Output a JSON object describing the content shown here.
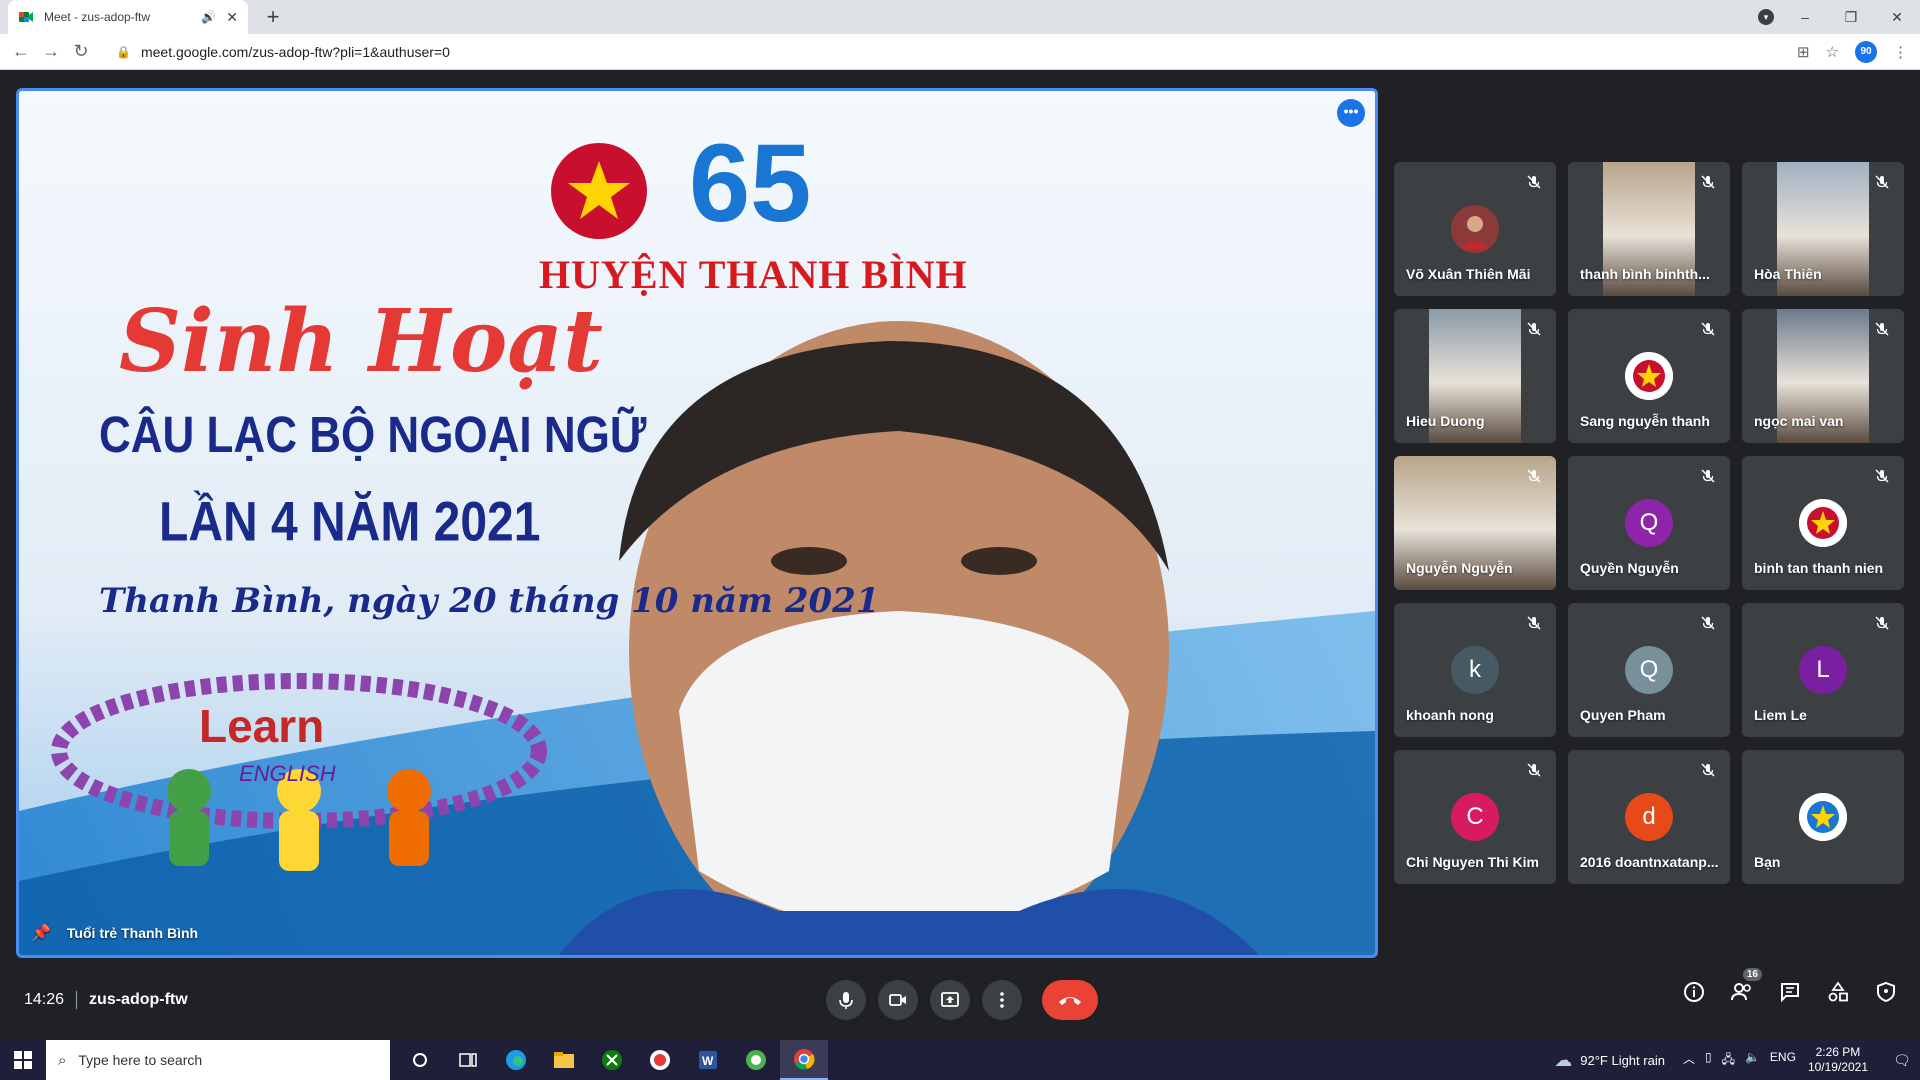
{
  "browser": {
    "tab_title": "Meet - zus-adop-ftw",
    "new_tab_symbol": "+",
    "url": "meet.google.com/zus-adop-ftw?pli=1&authuser=0",
    "window_controls": [
      "–",
      "❐",
      "✕"
    ]
  },
  "main_video": {
    "participant_name": "Tuổi trẻ Thanh Bình",
    "slide": {
      "badge_number": "65",
      "org": "HUYỆN THANH BÌNH",
      "title_script": "Sinh Hoạt",
      "line1": "CÂU LẠC BỘ NGOẠI NGỮ",
      "line2": "LẦN 4 NĂM 2021",
      "date_line": "Thanh Bình, ngày 20 tháng 10 năm 2021",
      "learn": "Learn",
      "english": "ENGLISH"
    }
  },
  "participants": [
    {
      "name": "Võ Xuân Thiên Mãi",
      "avatar": "photo",
      "avatar_color": "#8b3a3a",
      "muted": true
    },
    {
      "name": "thanh bình binhth...",
      "avatar": "video",
      "muted": true
    },
    {
      "name": "Hòa Thiên",
      "avatar": "video",
      "muted": true
    },
    {
      "name": "Hieu Duong",
      "avatar": "video",
      "muted": true
    },
    {
      "name": "Sang nguyễn thanh",
      "avatar": "logo",
      "avatar_color": "#ffffff",
      "muted": true
    },
    {
      "name": "ngọc mai van",
      "avatar": "video",
      "muted": true
    },
    {
      "name": "Nguyễn Nguyễn",
      "avatar": "video-full",
      "muted": true
    },
    {
      "name": "Quyền Nguyễn",
      "avatar": "Q",
      "avatar_color": "#8e24aa",
      "muted": true
    },
    {
      "name": "binh tan thanh nien",
      "avatar": "logo",
      "avatar_color": "#ffffff",
      "muted": true
    },
    {
      "name": "khoanh nong",
      "avatar": "k",
      "avatar_color": "#455a64",
      "muted": true
    },
    {
      "name": "Quyen Pham",
      "avatar": "Q",
      "avatar_color": "#78909c",
      "muted": true
    },
    {
      "name": "Liem Le",
      "avatar": "L",
      "avatar_color": "#7b1fa2",
      "muted": true
    },
    {
      "name": "Chi Nguyen Thi Kim",
      "avatar": "C",
      "avatar_color": "#d81b60",
      "muted": true
    },
    {
      "name": "2016 doantnxatanp...",
      "avatar": "d",
      "avatar_color": "#e64a19",
      "muted": true
    },
    {
      "name": "Bạn",
      "avatar": "logo90",
      "avatar_color": "#ffffff",
      "muted": false
    }
  ],
  "bottom_bar": {
    "time": "14:26",
    "meeting_code": "zus-adop-ftw",
    "people_count": "16"
  },
  "taskbar": {
    "search_placeholder": "Type here to search",
    "weather": "92°F  Light rain",
    "language": "ENG",
    "time": "2:26 PM",
    "date": "10/19/2021"
  },
  "colors": {
    "accent_blue": "#1a73e8",
    "end_call_red": "#ea4335",
    "tile_bg": "#3c4043",
    "stage_bg": "#202124"
  }
}
